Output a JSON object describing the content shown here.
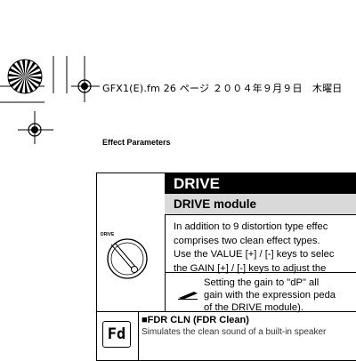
{
  "header": {
    "file_line": "GFX1(E).fm  26 ページ  ２００４年９月９日　木曜日"
  },
  "page": {
    "section": "Effect Parameters"
  },
  "module": {
    "title": "DRIVE",
    "subtitle": "DRIVE module",
    "knob_label": "DRIVE",
    "description": [
      "In addition to 9 distortion type effec",
      "comprises two clean effect types.",
      "Use the VALUE [+] / [-] keys to selec",
      "the GAIN [+] / [-] keys to adjust the"
    ],
    "note": [
      "Setting the gain to \"dP\" all",
      "gain with the expression peda",
      "of the DRIVE module)."
    ]
  },
  "effect": {
    "display_code": "Fd",
    "name": "■FDR CLN (FDR Clean)",
    "desc": "Simulates the clean sound of a built-in speaker"
  }
}
